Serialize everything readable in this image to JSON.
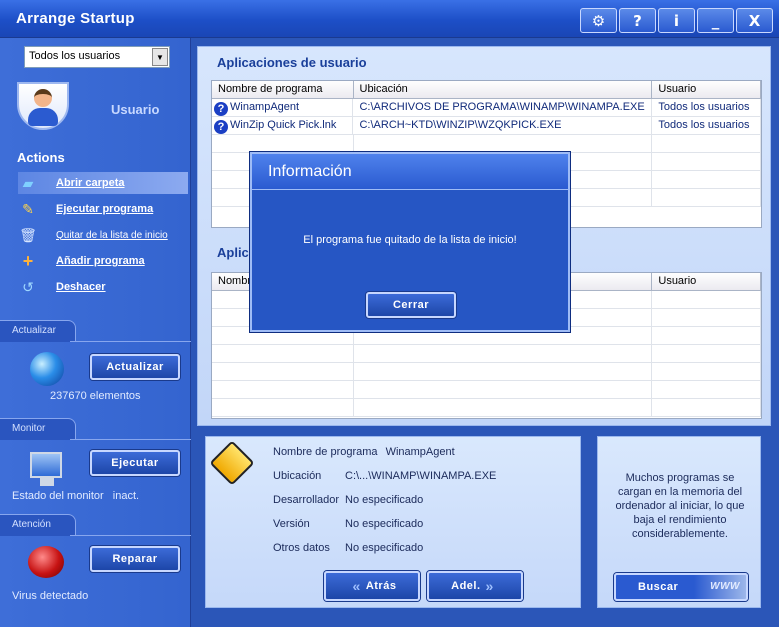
{
  "window": {
    "title": "Arrange Startup",
    "buttons": [
      {
        "name": "settings",
        "glyph": "⚙"
      },
      {
        "name": "help",
        "glyph": "?"
      },
      {
        "name": "info",
        "glyph": "i"
      },
      {
        "name": "minimize",
        "glyph": "_"
      },
      {
        "name": "close",
        "glyph": "X"
      }
    ]
  },
  "sidebar": {
    "user_select": "Todos los usuarios",
    "user_label": "Usuario",
    "actions_title": "Actions",
    "actions": [
      {
        "label": "Abrir carpeta",
        "icon": "folder-icon"
      },
      {
        "label": "Ejecutar programa",
        "icon": "run-icon"
      },
      {
        "label": "Quitar de la lista de inicio",
        "icon": "trash-icon"
      },
      {
        "label": "Añadir programa",
        "icon": "plus-icon"
      },
      {
        "label": "Deshacer",
        "icon": "undo-icon"
      }
    ],
    "update": {
      "tab": "Actualizar",
      "button": "Actualizar",
      "count": "237670 elementos"
    },
    "monitor": {
      "tab": "Monitor",
      "button": "Ejecutar",
      "status_label": "Estado del monitor",
      "status_value": "inact."
    },
    "attention": {
      "tab": "Atención",
      "button": "Reparar",
      "status": "Virus detectado"
    }
  },
  "user_apps": {
    "title": "Aplicaciones de usuario",
    "columns": [
      "Nombre de programa",
      "Ubicación",
      "Usuario"
    ],
    "rows": [
      {
        "name": "WinampAgent",
        "location": "C:\\ARCHIVOS DE PROGRAMA\\WINAMP\\WINAMPA.EXE",
        "user": "Todos los usuarios"
      },
      {
        "name": "WinZip Quick Pick.lnk",
        "location": "C:\\ARCH~KTD\\WINZIP\\WZQKPICK.EXE",
        "user": "Todos los usuarios"
      }
    ]
  },
  "system_apps": {
    "title_partial": "Aplic",
    "col_name_partial": "Nombr",
    "col_user": "Usuario"
  },
  "details": {
    "name_label": "Nombre de programa",
    "name_value": "WinampAgent",
    "location_label": "Ubicación",
    "location_value": "C:\\...\\WINAMP\\WINAMPA.EXE",
    "developer_label": "Desarrollador",
    "developer_value": "No especificado",
    "version_label": "Versión",
    "version_value": "No especificado",
    "other_label": "Otros datos",
    "other_value": "No especificado",
    "back_button": "Atrás",
    "next_button": "Adel."
  },
  "info_panel": {
    "text": "Muchos programas se cargan en la memoria del ordenador al iniciar, lo que baja el rendimiento considerablemente.",
    "search_button": "Buscar",
    "www": "WWW"
  },
  "dialog": {
    "title": "Información",
    "message": "El programa fue quitado de la lista de inicio!",
    "button": "Cerrar"
  }
}
